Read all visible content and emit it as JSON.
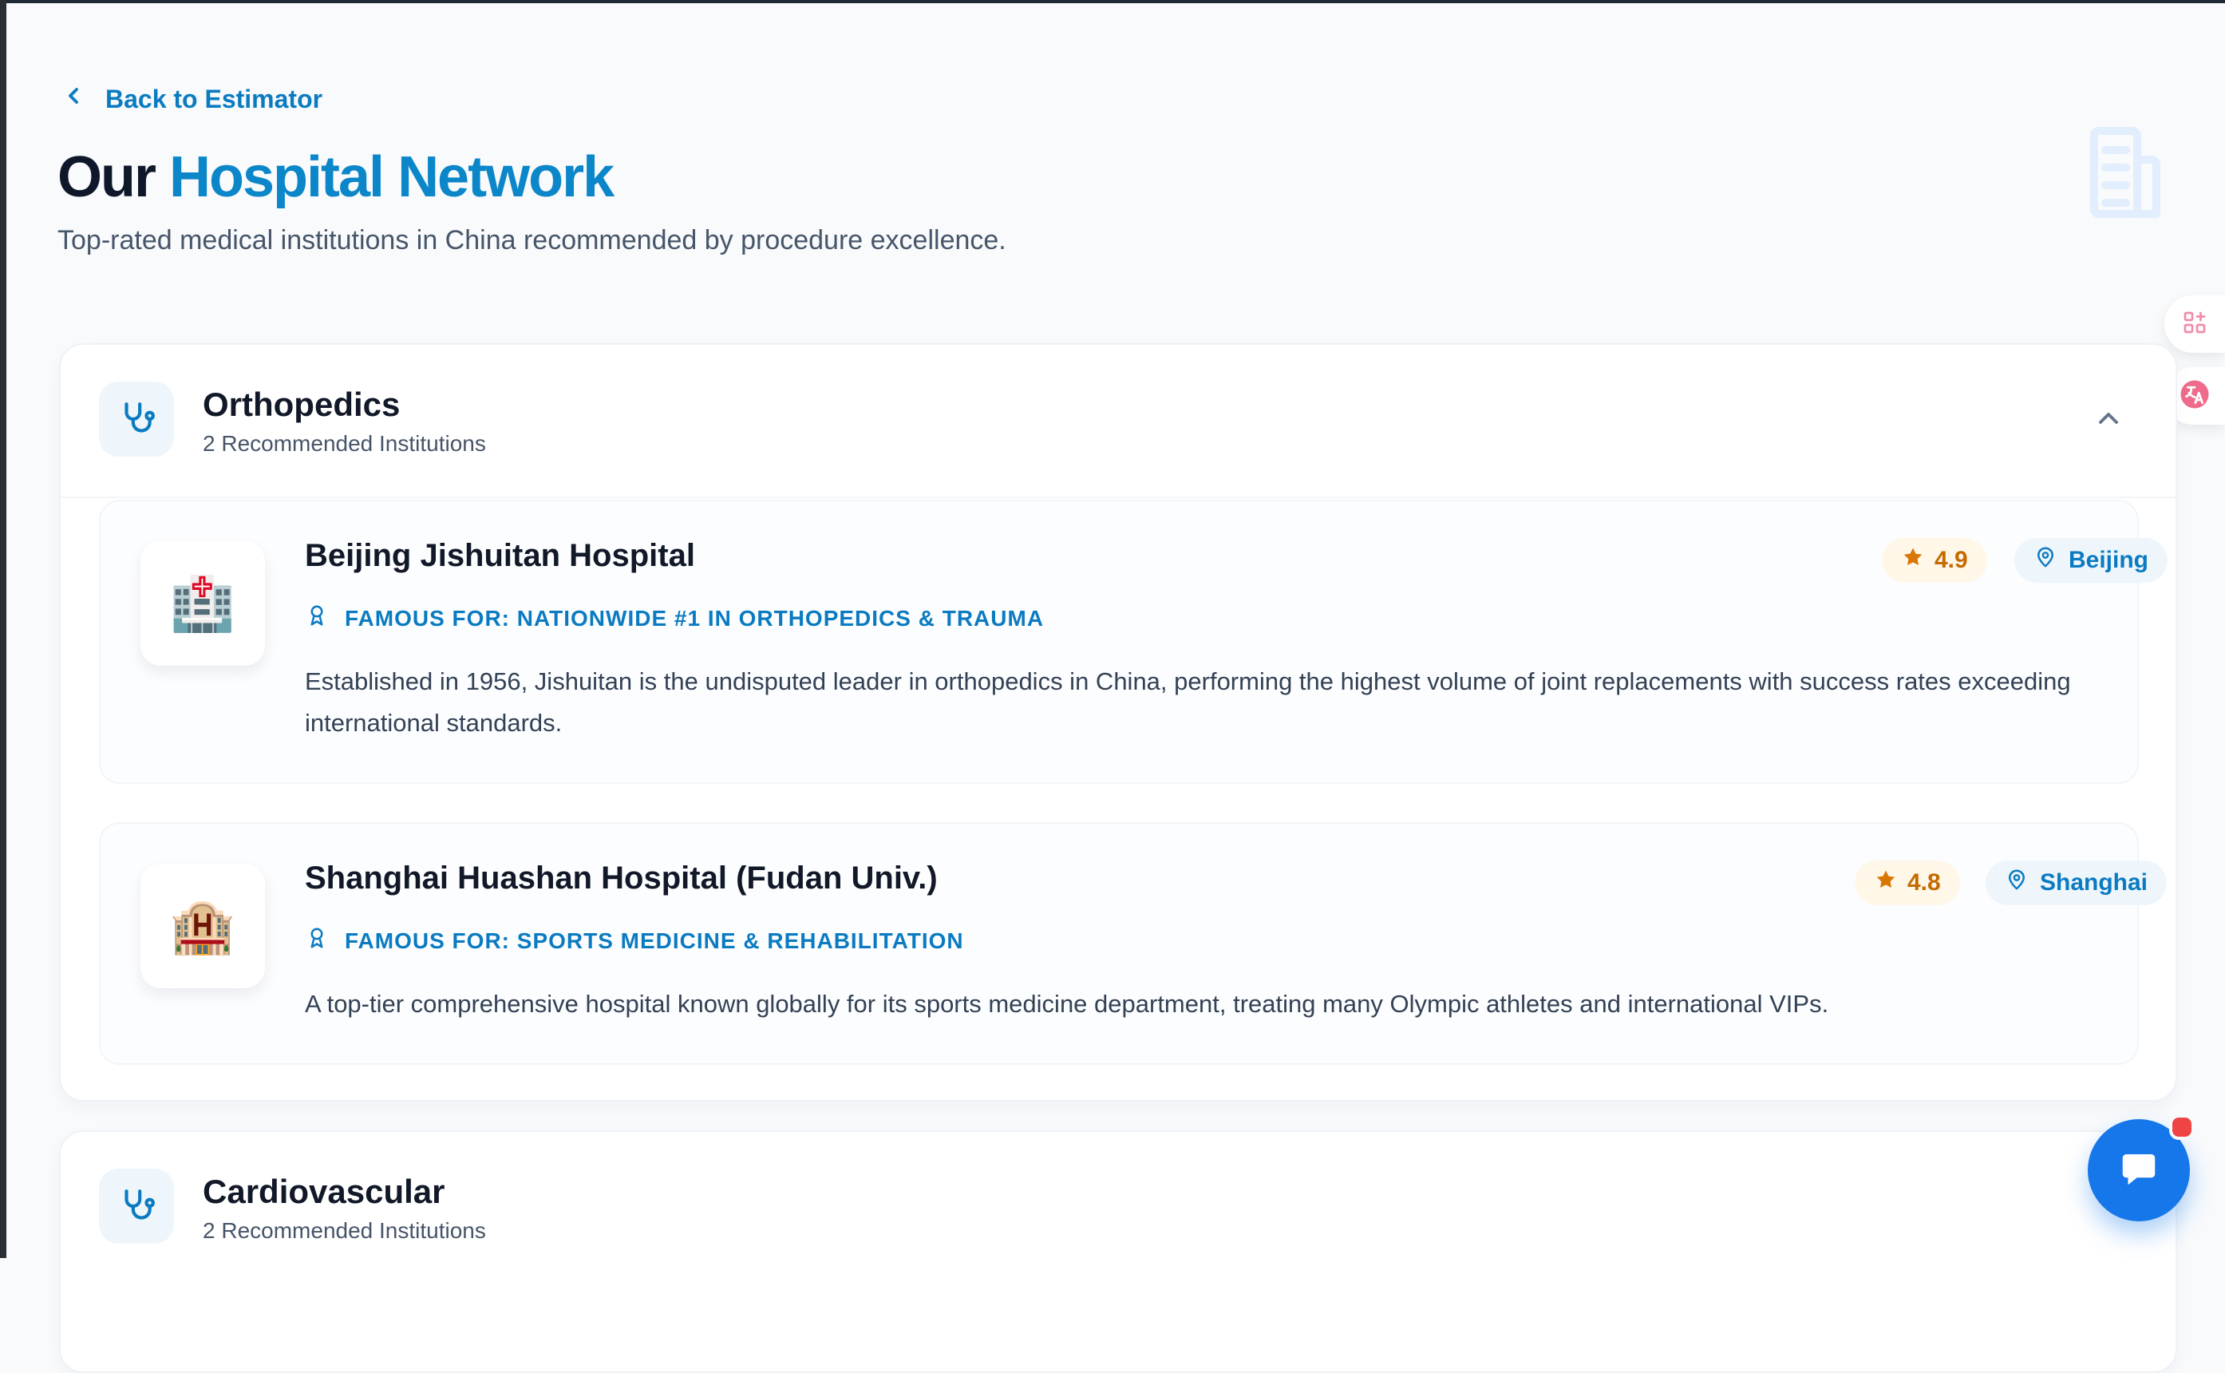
{
  "navigation": {
    "back_label": "Back to Estimator"
  },
  "header": {
    "title_prefix": "Our",
    "title_accent": "Hospital Network",
    "subtitle": "Top-rated medical institutions in China recommended by procedure excellence."
  },
  "icons": {
    "back": "chevron-left-icon",
    "hero": "building-icon",
    "section": "stethoscope-icon",
    "toggle": "chevron-up-icon",
    "famous": "ribbon-icon",
    "rating": "star-icon",
    "location": "map-pin-icon",
    "floating_one": "apps-icon",
    "floating_two": "translate-icon",
    "chat": "chat-icon"
  },
  "colors": {
    "accent": "#0b86c9",
    "background": "#f8fafc",
    "chat": "#1677ea",
    "rating_text": "#c46b00"
  },
  "sections": [
    {
      "name": "Orthopedics",
      "count": "2 Recommended Institutions",
      "hospitals": [
        {
          "name": "Beijing Jishuitan Hospital",
          "famous_for": "FAMOUS FOR: NATIONWIDE #1 IN ORTHOPEDICS & TRAUMA",
          "description": "Established in 1956, Jishuitan is the undisputed leader in orthopedics in China, performing the highest volume of joint replacements with success rates exceeding international standards.",
          "rating": "4.9",
          "location": "Beijing",
          "emoji": "🏥"
        },
        {
          "name": "Shanghai Huashan Hospital (Fudan Univ.)",
          "famous_for": "FAMOUS FOR: SPORTS MEDICINE & REHABILITATION",
          "description": "A top-tier comprehensive hospital known globally for its sports medicine department, treating many Olympic athletes and international VIPs.",
          "rating": "4.8",
          "location": "Shanghai",
          "emoji": "🏨"
        }
      ]
    },
    {
      "name": "Cardiovascular",
      "count": "2 Recommended Institutions"
    }
  ]
}
